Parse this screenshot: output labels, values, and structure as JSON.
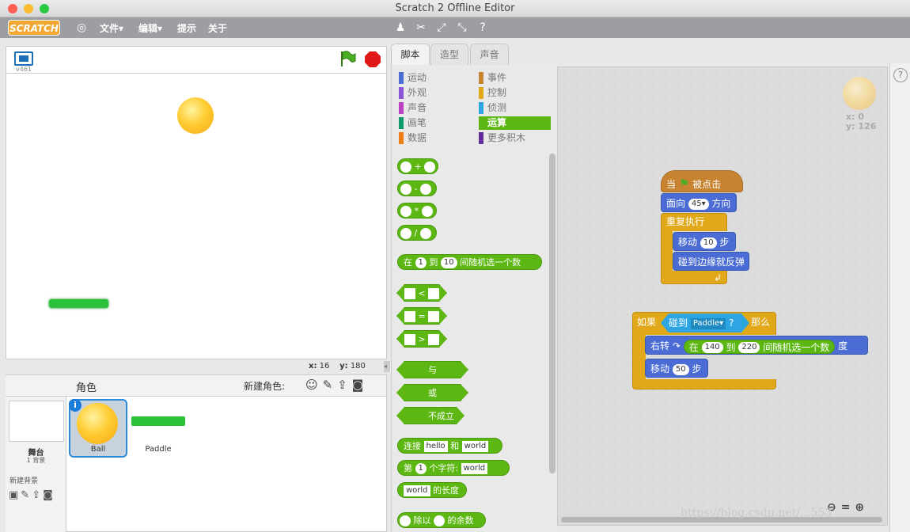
{
  "window": {
    "title": "Scratch 2 Offline Editor"
  },
  "menubar": {
    "logo": "SCRATCH",
    "file": "文件▾",
    "edit": "编辑▾",
    "tips": "提示",
    "about": "关于"
  },
  "stage": {
    "version": "v461",
    "x_label": "x:",
    "x_value": "16",
    "y_label": "y:",
    "y_value": "180"
  },
  "sprites_pane": {
    "title": "角色",
    "new_sprite": "新建角色:",
    "stage_label": "舞台",
    "backdrop_count": "1 背景",
    "new_backdrop": "新建背景",
    "sprites": [
      {
        "name": "Ball"
      },
      {
        "name": "Paddle"
      }
    ]
  },
  "tabs": [
    "脚本",
    "造型",
    "声音"
  ],
  "categories": {
    "left": [
      {
        "label": "运动",
        "color": "#4a6cd4"
      },
      {
        "label": "外观",
        "color": "#8a55d7"
      },
      {
        "label": "声音",
        "color": "#bb42c3"
      },
      {
        "label": "画笔",
        "color": "#0e9a6c"
      },
      {
        "label": "数据",
        "color": "#ee7d16"
      }
    ],
    "right": [
      {
        "label": "事件",
        "color": "#c88330"
      },
      {
        "label": "控制",
        "color": "#e1a91a"
      },
      {
        "label": "侦测",
        "color": "#2ca5e2"
      },
      {
        "label": "运算",
        "color": "#5cb712"
      },
      {
        "label": "更多积木",
        "color": "#632d99"
      }
    ]
  },
  "palette": {
    "plus": "+",
    "minus": "-",
    "times": "*",
    "divide": "/",
    "rand_pre": "在",
    "rand_a": "1",
    "rand_mid": "到",
    "rand_b": "10",
    "rand_post": "间随机选一个数",
    "lt": "<",
    "eq": "=",
    "gt": ">",
    "and": "与",
    "or": "或",
    "not": "不成立",
    "join_pre": "连接",
    "join_a": "hello",
    "join_mid": "和",
    "join_b": "world",
    "letter_pre": "第",
    "letter_n": "1",
    "letter_mid": "个字符:",
    "letter_s": "world",
    "len_s": "world",
    "len_post": "的长度",
    "mod_mid": "除以",
    "mod_post": "的余数"
  },
  "scripts": {
    "hat_pre": "当",
    "hat_post": "被点击",
    "point_pre": "面向",
    "point_val": "45▾",
    "point_post": "方向",
    "forever": "重复执行",
    "move1_pre": "移动",
    "move1_val": "10",
    "move1_post": "步",
    "bounce": "碰到边缘就反弹",
    "if_pre": "如果",
    "touch_pre": "碰到",
    "touch_val": "Paddle▾",
    "touch_q": "?",
    "if_post": "那么",
    "turn_pre": "右转",
    "turn_arrow": "↷",
    "rnd_pre": "在",
    "rnd_a": "140",
    "rnd_mid": "到",
    "rnd_b": "220",
    "rnd_post": "间随机选一个数",
    "turn_post": "度",
    "move2_pre": "移动",
    "move2_val": "50",
    "move2_post": "步"
  },
  "sprite_info": {
    "x": "x: 0",
    "y": "y: 126"
  },
  "watermark": "https://blog.csdn.net/...553"
}
